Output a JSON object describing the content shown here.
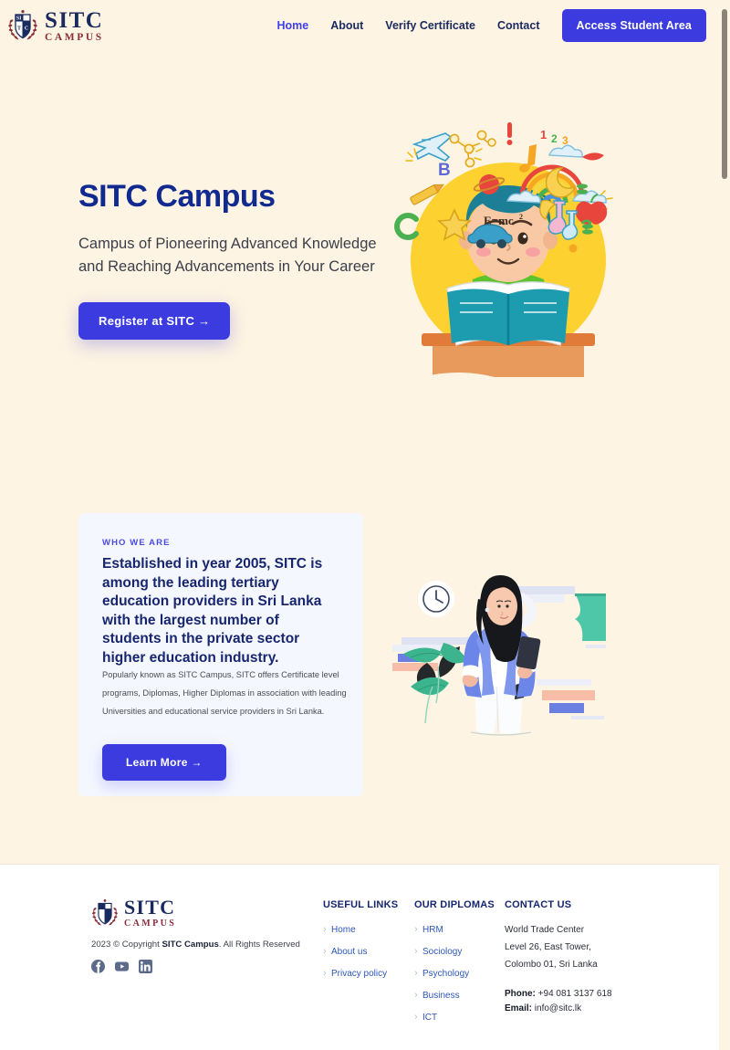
{
  "colors": {
    "page_bg": "#fdf4e3",
    "accent": "#3b3be0",
    "navy": "#17266e",
    "maroon": "#8c2d3c",
    "card_bg": "#f5f7ff",
    "footer_bg": "#ffffff"
  },
  "header": {
    "logo": {
      "icon": "shield-crest-logo",
      "main": "SITC",
      "sub": "CAMPUS"
    },
    "nav": [
      {
        "label": "Home",
        "active": true
      },
      {
        "label": "About",
        "active": false
      },
      {
        "label": "Verify Certificate",
        "active": false
      },
      {
        "label": "Contact",
        "active": false
      }
    ],
    "cta_label": "Access Student Area"
  },
  "hero": {
    "title": "SITC Campus",
    "subtitle": "Campus of Pioneering Advanced Knowledge and Reaching Advancements in Your Career",
    "cta_label": "Register at SITC",
    "cta_arrow": "→",
    "illustration": "child-reading-book-with-learning-doodles"
  },
  "about": {
    "eyebrow": "WHO WE ARE",
    "heading": "Established in year 2005, SITC is among the leading tertiary education providers in Sri Lanka with the largest number of students in the private sector higher education industry.",
    "body": "Popularly known as SITC Campus, SITC offers Certificate level programs, Diplomas, Higher Diplomas in association with leading Universities and educational service providers in Sri Lanka.",
    "cta_label": "Learn More",
    "cta_arrow": "→",
    "illustration": "woman-with-tablet-and-plants"
  },
  "footer": {
    "logo": {
      "main": "SITC",
      "sub": "CAMPUS"
    },
    "copyright_prefix": "2023 © Copyright ",
    "copyright_brand": "SITC Campus",
    "copyright_suffix": ". All Rights Reserved",
    "socials": [
      {
        "name": "facebook-icon"
      },
      {
        "name": "youtube-icon"
      },
      {
        "name": "linkedin-icon"
      }
    ],
    "columns": {
      "useful_links": {
        "title": "USEFUL LINKS",
        "items": [
          "Home",
          "About us",
          "Privacy policy"
        ]
      },
      "diplomas": {
        "title": "OUR DIPLOMAS",
        "items": [
          "HRM",
          "Sociology",
          "Psychology",
          "Business",
          "ICT"
        ]
      },
      "contact": {
        "title": "CONTACT US",
        "address": [
          "World Trade Center",
          "Level 26, East Tower,",
          "Colombo 01, Sri Lanka"
        ],
        "phone_label": "Phone:",
        "phone_value": " +94 081 3137 618",
        "email_label": "Email:",
        "email_value": " info@sitc.lk"
      }
    }
  }
}
